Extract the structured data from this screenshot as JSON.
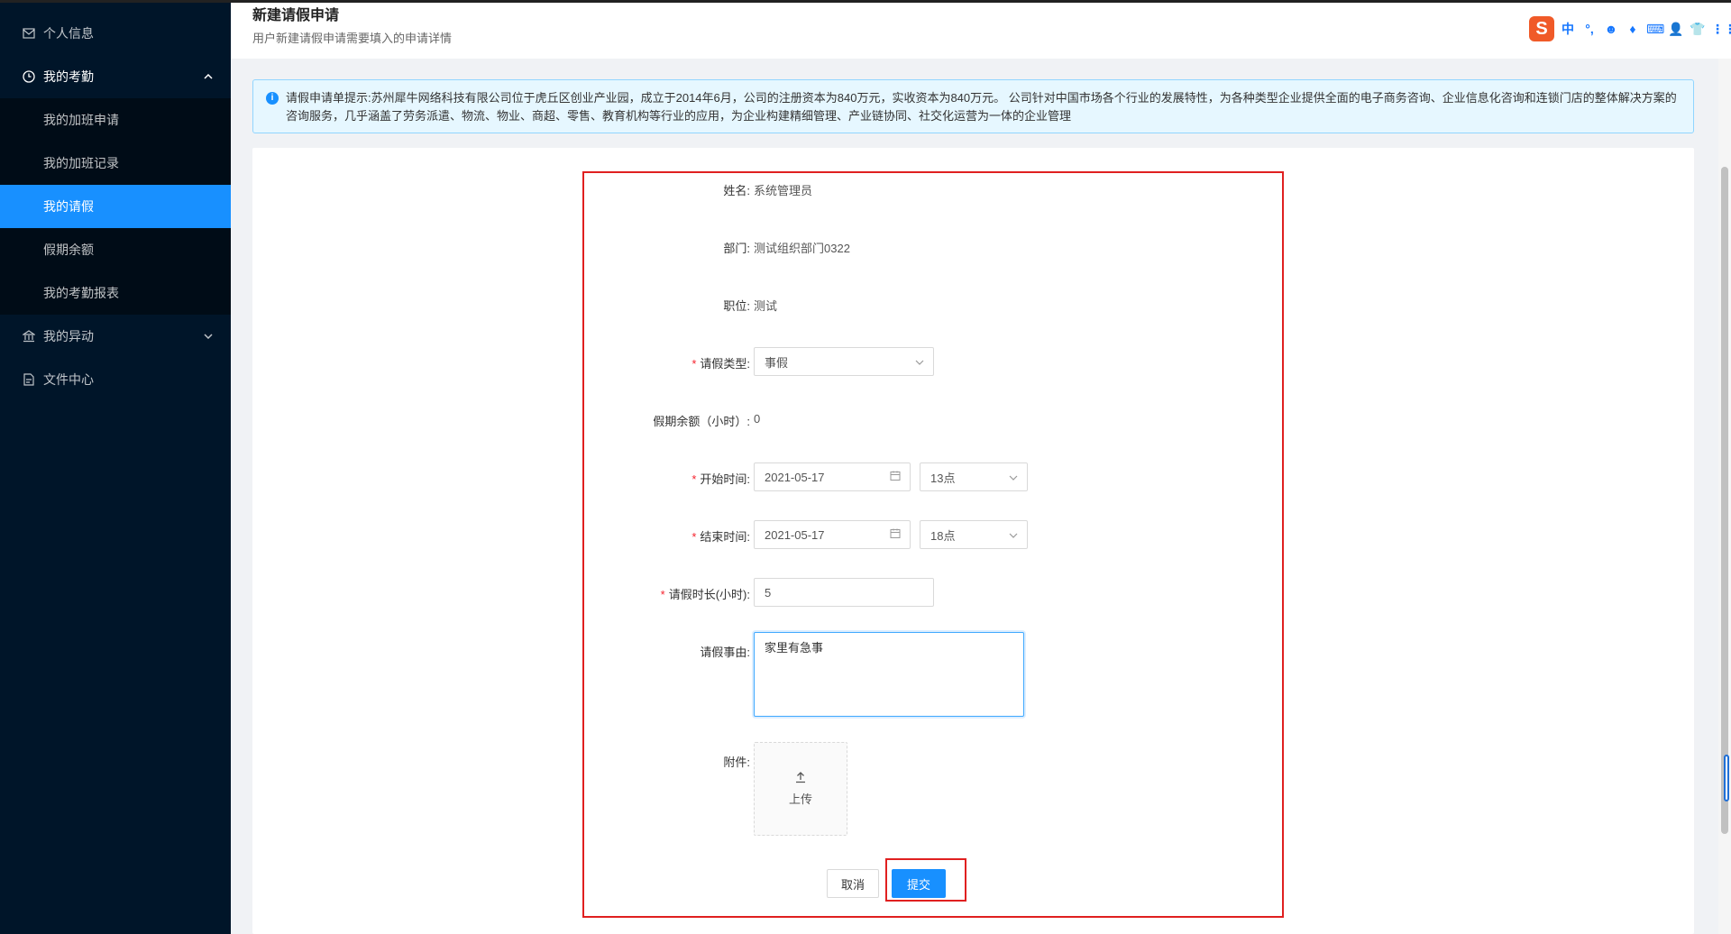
{
  "sidebar": {
    "items": [
      {
        "label": "个人信息",
        "icon": "mail-icon"
      },
      {
        "label": "我的考勤",
        "icon": "clock-icon",
        "open": true
      },
      {
        "label": "我的异动",
        "icon": "bank-icon"
      },
      {
        "label": "文件中心",
        "icon": "file-icon"
      }
    ],
    "attendance_sub": [
      {
        "label": "我的加班申请"
      },
      {
        "label": "我的加班记录"
      },
      {
        "label": "我的请假",
        "active": true
      },
      {
        "label": "假期余额"
      },
      {
        "label": "我的考勤报表"
      }
    ]
  },
  "header": {
    "title": "新建请假申请",
    "subtitle": "用户新建请假申请需要填入的申请详情"
  },
  "ime": {
    "logo": "S",
    "items": [
      "中",
      "°,",
      "☻",
      "♦",
      "⌨",
      "👤",
      "👕",
      "⋮⋮"
    ]
  },
  "alert": {
    "text": "请假申请单提示:苏州犀牛网络科技有限公司位于虎丘区创业产业园，成立于2014年6月，公司的注册资本为840万元，实收资本为840万元。 公司针对中国市场各个行业的发展特性，为各种类型企业提供全面的电子商务咨询、企业信息化咨询和连锁门店的整体解决方案的咨询服务，几乎涵盖了劳务派遣、物流、物业、商超、零售、教育机构等行业的应用，为企业构建精细管理、产业链协同、社交化运营为一体的企业管理"
  },
  "form": {
    "name": {
      "label": "姓名:",
      "value": "系统管理员"
    },
    "dept": {
      "label": "部门:",
      "value": "测试组织部门0322"
    },
    "position": {
      "label": "职位:",
      "value": "测试"
    },
    "leave_type": {
      "label": "请假类型:",
      "value": "事假"
    },
    "balance": {
      "label": "假期余额（小时）:",
      "value": "0"
    },
    "start": {
      "label": "开始时间:",
      "date": "2021-05-17",
      "hour": "13点"
    },
    "end": {
      "label": "结束时间:",
      "date": "2021-05-17",
      "hour": "18点"
    },
    "duration": {
      "label": "请假时长(小时):",
      "value": "5"
    },
    "reason": {
      "label": "请假事由:",
      "value": "家里有急事"
    },
    "attachment": {
      "label": "附件:",
      "upload_label": "上传"
    },
    "cancel_label": "取消",
    "submit_label": "提交"
  },
  "colors": {
    "sidebar_bg": "#001529",
    "active": "#1890ff",
    "highlight_border": "#e02020"
  }
}
